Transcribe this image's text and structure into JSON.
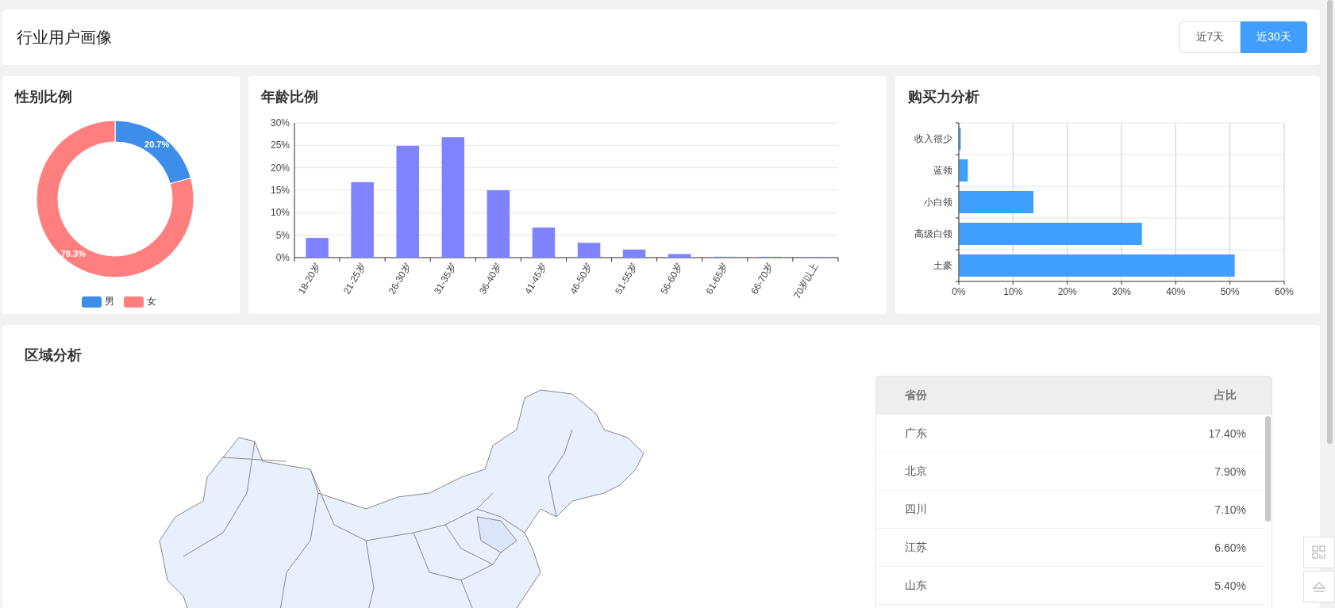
{
  "header": {
    "title": "行业用户画像",
    "ranges": [
      {
        "label": "近7天",
        "selected": false
      },
      {
        "label": "近30天",
        "selected": true
      }
    ]
  },
  "gender": {
    "title": "性别比例",
    "chart_data": {
      "type": "donut",
      "categories": [
        "男",
        "女"
      ],
      "values": [
        20.7,
        79.3
      ],
      "colors": [
        "#3d8ee8",
        "#ff7f7f"
      ],
      "value_labels": [
        "20.7%",
        "79.3%"
      ],
      "legend": true
    }
  },
  "age": {
    "title": "年龄比例",
    "chart_data": {
      "type": "bar",
      "grid": true,
      "categories": [
        "18-20岁",
        "21-25岁",
        "26-30岁",
        "31-35岁",
        "36-40岁",
        "41-45岁",
        "46-50岁",
        "51-55岁",
        "56-60岁",
        "61-65岁",
        "66-70岁",
        "70岁以上"
      ],
      "series": [
        {
          "color": "#7f83ff",
          "values": [
            4.4,
            16.8,
            24.9,
            26.8,
            15.0,
            6.7,
            3.3,
            1.8,
            0.8,
            0.2,
            0.2,
            0.1
          ]
        }
      ],
      "ylim": [
        0,
        30
      ],
      "yticks": [
        {
          "value": 0,
          "label": "0%"
        },
        {
          "value": 5,
          "label": "5%"
        },
        {
          "value": 10,
          "label": "10%"
        },
        {
          "value": 15,
          "label": "15%"
        },
        {
          "value": 20,
          "label": "20%"
        },
        {
          "value": 25,
          "label": "25%"
        },
        {
          "value": 30,
          "label": "30%"
        }
      ]
    }
  },
  "purchase": {
    "title": "购买力分析",
    "chart_data": {
      "type": "bar",
      "orientation": "horizontal",
      "grid": true,
      "categories": [
        "收入很少",
        "蓝领",
        "小白领",
        "高级白领",
        "土豪"
      ],
      "series": [
        {
          "color": "#409eff",
          "values": [
            0.1,
            1.6,
            13.7,
            33.7,
            50.8
          ]
        }
      ],
      "xlim": [
        0,
        60
      ],
      "xticks": [
        {
          "value": 0,
          "label": "0%"
        },
        {
          "value": 10,
          "label": "10%"
        },
        {
          "value": 20,
          "label": "20%"
        },
        {
          "value": 30,
          "label": "30%"
        },
        {
          "value": 40,
          "label": "40%"
        },
        {
          "value": 50,
          "label": "50%"
        },
        {
          "value": 60,
          "label": "60%"
        }
      ]
    }
  },
  "region": {
    "title": "区域分析",
    "table": {
      "columns": [
        "省份",
        "占比"
      ],
      "rows": [
        [
          "广东",
          "17.40%"
        ],
        [
          "北京",
          "7.90%"
        ],
        [
          "四川",
          "7.10%"
        ],
        [
          "江苏",
          "6.60%"
        ],
        [
          "山东",
          "5.40%"
        ]
      ]
    }
  }
}
